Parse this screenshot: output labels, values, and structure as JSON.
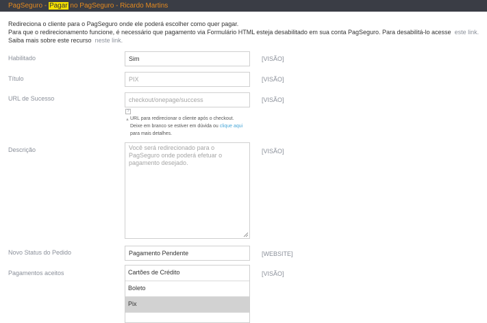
{
  "header": {
    "title_part1": "PagSeguro - ",
    "title_highlight": "Pagar",
    "title_part2": " no PagSeguro - Ricardo Martins"
  },
  "intro": {
    "line1": "Redireciona o cliente para o PagSeguro onde ele poderá escolher como quer pagar.",
    "line2": "Para que o redirecionamento funcione, é necessário que pagamento via Formulário HTML esteja desabilitado em sua conta PagSeguro. Para desabilitá-lo acesse",
    "line2_link": "este link.",
    "line3": "Saiba mais sobre este recurso",
    "line3_link": "neste link."
  },
  "fields": {
    "enabled": {
      "label": "Habilitado",
      "value": "Sim",
      "scope": "[VISÃO]"
    },
    "title": {
      "label": "Título",
      "placeholder": "PIX",
      "scope": "[VISÃO]"
    },
    "success_url": {
      "label": "URL de Sucesso",
      "placeholder": "checkout/onepage/success",
      "scope": "[VISÃO]"
    },
    "description": {
      "label": "Descrição",
      "placeholder": "Você será redirecionado para o PagSeguro onde poderá efetuar o pagamento desejado.",
      "scope": "[VISÃO]"
    },
    "order_status": {
      "label": "Novo Status do Pedido",
      "value": "Pagamento Pendente",
      "scope": "[WEBSITE]"
    },
    "payments": {
      "label": "Pagamentos aceitos",
      "scope": "[VISÃO]",
      "options": [
        "Cartões de Crédito",
        "Boleto",
        "Pix"
      ],
      "selected": "Pix"
    }
  },
  "help": {
    "icon": "?",
    "line1": "URL para redirecionar o cliente após o checkout.",
    "line2": "Deixe em branco se estiver em dúvida ou",
    "line2_link": "clique aqui",
    "line3": "para mais detalhes."
  }
}
